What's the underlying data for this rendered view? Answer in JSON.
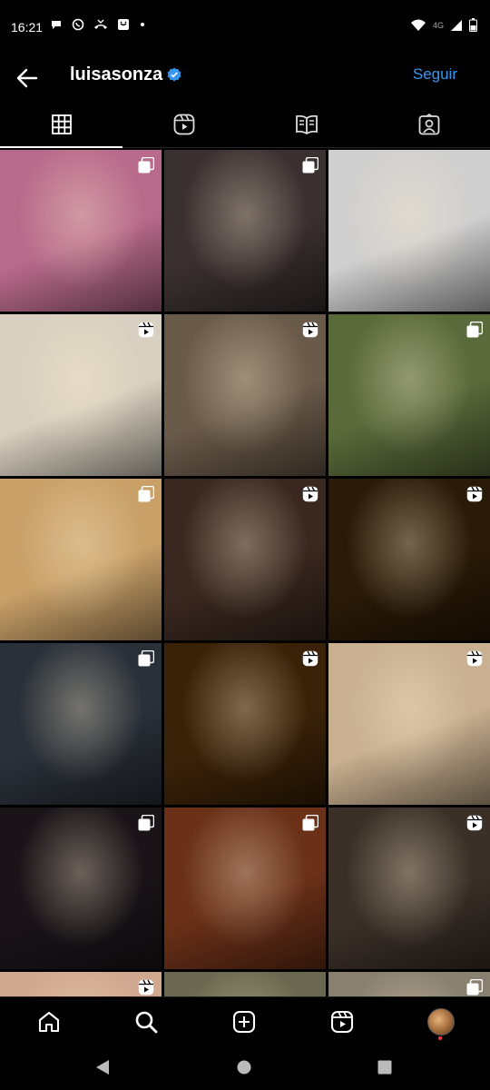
{
  "status_bar": {
    "time": "16:21",
    "network": "4G",
    "icons": [
      "chat-bubble-icon",
      "whatsapp-icon",
      "missed-call-icon",
      "messenger-icon",
      "dot-icon",
      "wifi-icon",
      "signal-icon",
      "battery-icon"
    ]
  },
  "header": {
    "username": "luisasonza",
    "verified": true,
    "follow_label": "Seguir"
  },
  "tabs": [
    {
      "name": "grid",
      "icon": "grid-icon",
      "active": true
    },
    {
      "name": "reels",
      "icon": "reels-icon",
      "active": false
    },
    {
      "name": "guides",
      "icon": "guide-book-icon",
      "active": false
    },
    {
      "name": "tagged",
      "icon": "tagged-person-icon",
      "active": false
    }
  ],
  "posts": [
    {
      "badge": "multi",
      "bg": "#b86a8a"
    },
    {
      "badge": "multi",
      "bg": "#3a3030"
    },
    {
      "badge": "none",
      "bg": "#cfcfcf"
    },
    {
      "badge": "reel",
      "bg": "#d8d0c0"
    },
    {
      "badge": "reel",
      "bg": "#6a5a4a"
    },
    {
      "badge": "multi",
      "bg": "#5a6a3a"
    },
    {
      "badge": "multi",
      "bg": "#c8a068"
    },
    {
      "badge": "reel",
      "bg": "#3a2820"
    },
    {
      "badge": "reel",
      "bg": "#2a1a08"
    },
    {
      "badge": "multi",
      "bg": "#2a3038"
    },
    {
      "badge": "reel",
      "bg": "#3a2208"
    },
    {
      "badge": "reel",
      "bg": "#c8b090"
    },
    {
      "badge": "multi",
      "bg": "#1a1418"
    },
    {
      "badge": "multi",
      "bg": "#6a3018"
    },
    {
      "badge": "reel",
      "bg": "#3a3028"
    },
    {
      "badge": "reel",
      "bg": "#d0a890"
    },
    {
      "badge": "none",
      "bg": "#6a6850"
    },
    {
      "badge": "multi",
      "bg": "#8a8070"
    }
  ],
  "bottom_nav": [
    "home-icon",
    "search-icon",
    "create-icon",
    "reels-icon",
    "profile-avatar"
  ],
  "colors": {
    "accent": "#3897f0",
    "verified": "#3897f0",
    "background": "#000000"
  }
}
